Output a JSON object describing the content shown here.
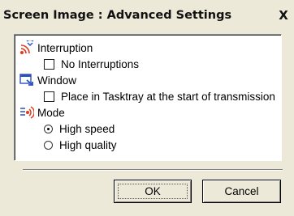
{
  "window": {
    "title": "Screen Image : Advanced Settings",
    "close_label": "X"
  },
  "sections": {
    "interruption": {
      "label": "Interruption",
      "icon": "signal-icon",
      "option_label": "No Interruptions",
      "option_checked": false
    },
    "window": {
      "label": "Window",
      "icon": "window-icon",
      "option_label": "Place in Tasktray at the start of transmission",
      "option_checked": false
    },
    "mode": {
      "label": "Mode",
      "icon": "mode-icon",
      "options": [
        {
          "label": "High speed",
          "selected": true
        },
        {
          "label": "High quality",
          "selected": false
        }
      ]
    }
  },
  "buttons": {
    "ok_label": "OK",
    "cancel_label": "Cancel"
  },
  "colors": {
    "dialog_bg": "#ece9d8",
    "panel_bg": "#ffffff",
    "icon_red": "#e23a1a",
    "icon_blue": "#2a4fbf"
  }
}
